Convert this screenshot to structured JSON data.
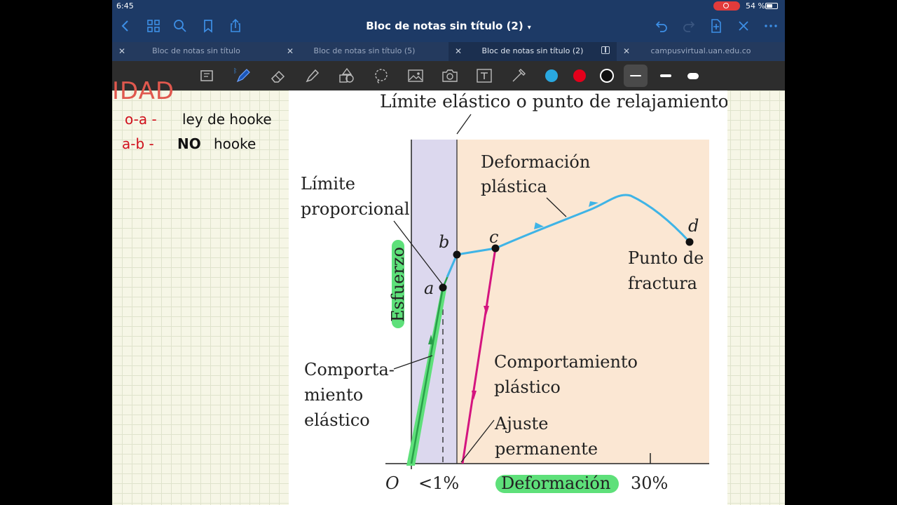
{
  "status": {
    "time": "6:45",
    "battery": "54 %"
  },
  "nav": {
    "title": "Bloc de notas sin título (2)"
  },
  "tabs": [
    {
      "label": "Bloc de notas sin título"
    },
    {
      "label": "Bloc de notas sin título (5)"
    },
    {
      "label": "Bloc de notas sin título (2)"
    },
    {
      "label": "campusvirtual.uan.edu.co"
    }
  ],
  "toolbar": {
    "colors": [
      "#29a8e0",
      "#e3001b",
      "#111111"
    ]
  },
  "notes": {
    "heading_fragment": "IDAD",
    "line1_red": "o-a -",
    "line1_black": "ley de hooke",
    "line2_red": "a-b -",
    "line2_bold": "NO",
    "line2_black": "hooke"
  },
  "figure": {
    "top_label": "Límite elástico o punto de relajamiento",
    "deformacion_plastica": [
      "Deformación",
      "plástica"
    ],
    "limite_proporcional": [
      "Límite",
      "proporcional"
    ],
    "point_a": "a",
    "point_b": "b",
    "point_c": "c",
    "point_d": "d",
    "punto_fractura": [
      "Punto de",
      "fractura"
    ],
    "esfuerzo": "Esfuerzo",
    "comp_elastico": [
      "Comporta-",
      "miento",
      "elástico"
    ],
    "comp_plastico": [
      "Comportamiento",
      "plástico"
    ],
    "ajuste": [
      "Ajuste",
      "permanente"
    ],
    "origin": "O",
    "lt1": "<1%",
    "deformacion_axis": "Deformación",
    "p30": "30%"
  }
}
